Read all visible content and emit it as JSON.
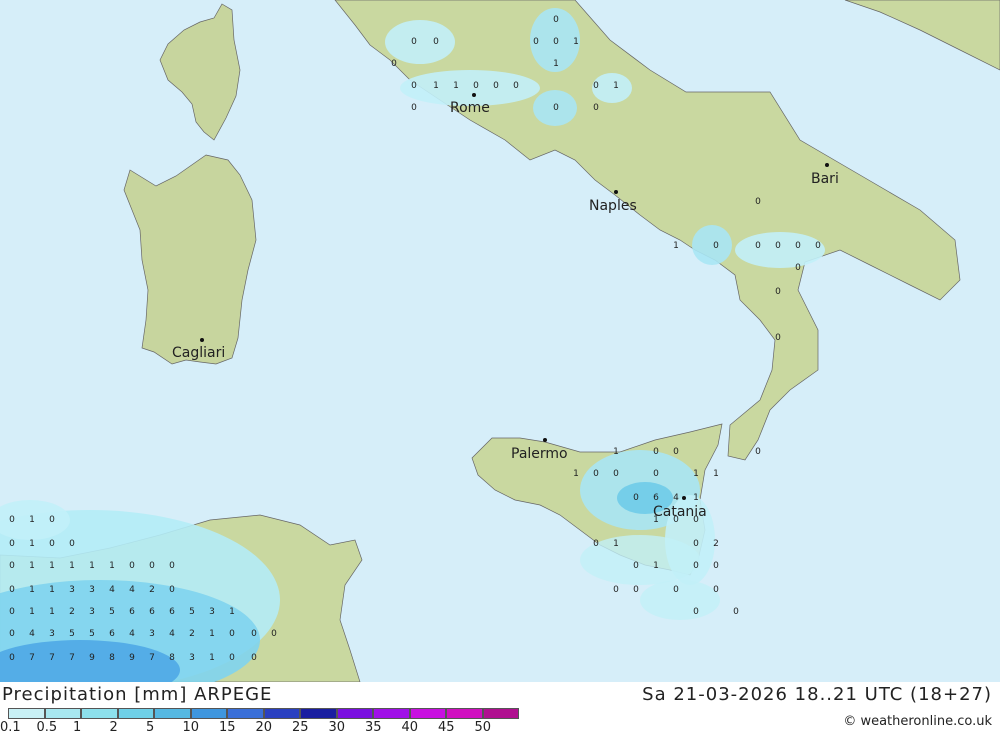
{
  "map": {
    "cities": [
      {
        "name": "Rome"
      },
      {
        "name": "Naples"
      },
      {
        "name": "Bari"
      },
      {
        "name": "Cagliari"
      },
      {
        "name": "Palermo"
      },
      {
        "name": "Catania"
      }
    ],
    "values": [
      "0",
      "0",
      "0",
      "0",
      "1",
      "1",
      "0",
      "0",
      "0",
      "0",
      "0",
      "0",
      "1",
      "1",
      "0",
      "0",
      "1",
      "0",
      "0",
      "0",
      "1",
      "0",
      "0",
      "0",
      "0",
      "0",
      "0",
      "0",
      "0",
      "0",
      "1",
      "0",
      "0",
      "1",
      "0",
      "0",
      "0",
      "1",
      "1",
      "0",
      "6",
      "4",
      "1",
      "1",
      "0",
      "0",
      "0",
      "1",
      "0",
      "2",
      "0",
      "1",
      "0",
      "0",
      "0",
      "0",
      "0",
      "0",
      "0",
      "0",
      "0",
      "1",
      "0",
      "0",
      "1",
      "0",
      "0",
      "0",
      "1",
      "1",
      "1",
      "1",
      "1",
      "0",
      "0",
      "0",
      "0",
      "1",
      "1",
      "3",
      "3",
      "4",
      "4",
      "2",
      "0",
      "0",
      "1",
      "1",
      "2",
      "3",
      "5",
      "6",
      "6",
      "6",
      "5",
      "3",
      "1",
      "0",
      "4",
      "3",
      "5",
      "5",
      "6",
      "4",
      "3",
      "4",
      "2",
      "1",
      "0",
      "0",
      "0",
      "0",
      "7",
      "7",
      "7",
      "9",
      "8",
      "9",
      "7",
      "8",
      "3",
      "1",
      "0",
      "0",
      "0"
    ]
  },
  "footer": {
    "title": "Precipitation [mm] ARPEGE",
    "timestamp": "Sa 21-03-2026 18..21 UTC (18+27)",
    "credit": "© weatheronline.co.uk"
  },
  "legend": {
    "ticks": [
      "0.1",
      "0.5",
      "1",
      "2",
      "5",
      "10",
      "15",
      "20",
      "25",
      "30",
      "35",
      "40",
      "45",
      "50"
    ],
    "colors": [
      "#c8f0f5",
      "#a8e8f0",
      "#8de0ec",
      "#6fd0e8",
      "#55b8e2",
      "#3f96de",
      "#3a6fd8",
      "#2a40c0",
      "#1a1ea0",
      "#7a10e0",
      "#a010e8",
      "#c810e0",
      "#d010c0",
      "#b01090"
    ]
  },
  "colors": {
    "sea": "#d4eef9",
    "land": "#c9d8a0",
    "precip_light": "#bff0f8",
    "precip_mid": "#7fd4ee",
    "precip_heavy": "#4aa6e6"
  }
}
